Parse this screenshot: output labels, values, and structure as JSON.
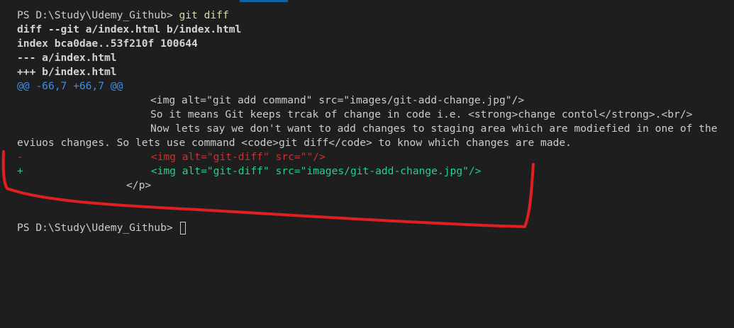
{
  "prompt1": "PS D:\\Study\\Udemy_Github> ",
  "command": "git diff",
  "header": {
    "diff": "diff --git a/index.html b/index.html",
    "index": "index bca0dae..53f210f 100644",
    "minus": "--- a/index.html",
    "plus": "+++ b/index.html"
  },
  "hunk": "@@ -66,7 +66,7 @@",
  "context": [
    "<img alt=\"git add command\" src=\"images/git-add-change.jpg\"/>",
    "So it means Git keeps trcak of change in code i.e. <strong>change contol</strong>.<br/>",
    "Now lets say we don't want to add changes to staging area which are modiefied in one of the",
    "eviuos changes. So lets use command <code>git diff</code> to know which changes are made."
  ],
  "removed": {
    "marker": "-",
    "text": "<img alt=\"git-diff\" src=\"\"/>"
  },
  "added": {
    "marker": "+",
    "text": "<img alt=\"git-diff\" src=\"images/git-add-change.jpg\"/>"
  },
  "closing": "</p>",
  "prompt2": "PS D:\\Study\\Udemy_Github> ",
  "colors": {
    "background": "#1e1e1e",
    "removed": "#cd3131",
    "added": "#23d18b",
    "hunk": "#3b8eea",
    "annotation": "#e02020"
  }
}
